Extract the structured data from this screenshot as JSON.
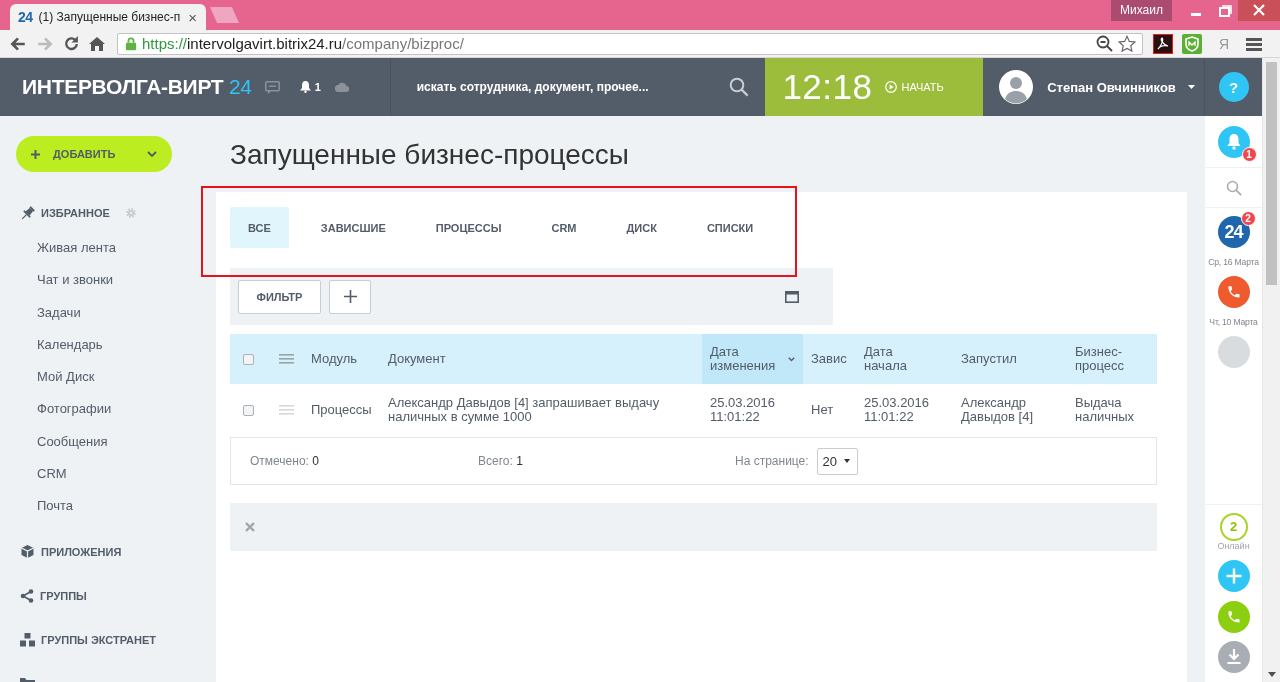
{
  "browser": {
    "tabs": [
      {
        "favicon": "24",
        "title": "(1) Запущенные бизнес-п",
        "close": "×",
        "selected": true
      }
    ],
    "profile": "Михаил",
    "url": {
      "scheme": "https://",
      "host": "intervolgavirt.bitrix24.ru",
      "path": "/company/bizproc/"
    },
    "yandex": "Я"
  },
  "header": {
    "logo": {
      "name": "ИНТЕРВОЛГА-ВИРТ",
      "number": "24"
    },
    "notifications": "1",
    "search": {
      "placeholder": "искать сотрудника, документ, прочее..."
    },
    "clock": {
      "time": "12:18",
      "start": "НАЧАТЬ"
    },
    "user": {
      "name": "Степан Овчинников"
    },
    "help": "?"
  },
  "sidebar": {
    "add_button": "ДОБАВИТЬ",
    "sections": [
      {
        "kind": "favorites",
        "label": "ИЗБРАННОЕ",
        "items": [
          "Живая лента",
          "Чат и звонки",
          "Задачи",
          "Календарь",
          "Мой Диск",
          "Фотографии",
          "Сообщения",
          "CRM",
          "Почта"
        ]
      },
      {
        "kind": "apps",
        "label": "ПРИЛОЖЕНИЯ"
      },
      {
        "kind": "groups",
        "label": "ГРУППЫ"
      },
      {
        "kind": "extranet",
        "label": "ГРУППЫ ЭКСТРАНЕТ"
      },
      {
        "kind": "crm"
      }
    ]
  },
  "page": {
    "title": "Запущенные бизнес-процессы",
    "tabs_highlighted": true,
    "tabs": [
      {
        "label": "ВСЕ",
        "selected": true
      },
      {
        "label": "ЗАВИСШИЕ",
        "selected": false
      },
      {
        "label": "ПРОЦЕССЫ",
        "selected": false
      },
      {
        "label": "CRM",
        "selected": false
      },
      {
        "label": "ДИСК",
        "selected": false
      },
      {
        "label": "СПИСКИ",
        "selected": false
      }
    ],
    "filter": {
      "button": "ФИЛЬТР"
    },
    "table": {
      "select_all_checked": false,
      "columns": [
        {
          "label": "Модуль",
          "sorted": false
        },
        {
          "label": "Документ",
          "sorted": false
        },
        {
          "label": "Дата изменения",
          "sorted": true
        },
        {
          "label": "Завис",
          "sorted": false
        },
        {
          "label": "Дата начала",
          "sorted": false
        },
        {
          "label": "Запустил",
          "sorted": false
        },
        {
          "label": "Бизнес-процесс",
          "sorted": false
        }
      ],
      "rows": [
        {
          "checked": false,
          "cells": [
            "Процессы",
            "Александр Давыдов [4] запрашивает выдачу наличных в сумме 1000",
            "25.03.2016 11:01:22",
            "Нет",
            "25.03.2016 11:01:22",
            "Александр Давыдов [4]",
            "Выдача наличных"
          ]
        }
      ]
    },
    "footer": {
      "checked_label": "Отмечено:",
      "checked_count": "0",
      "total_label": "Всего:",
      "total_count": "1",
      "per_page_label": "На странице:",
      "per_page": "20"
    }
  },
  "messenger": {
    "notifications_badge": "1",
    "recent": [
      {
        "kind": "chat",
        "logo": "24",
        "badge": "2",
        "date": "Ср, 16 Марта"
      },
      {
        "kind": "call",
        "date": "Чт, 10 Марта"
      },
      {
        "kind": "contact"
      }
    ],
    "online_count": "2",
    "online_label": "Онлайн"
  }
}
